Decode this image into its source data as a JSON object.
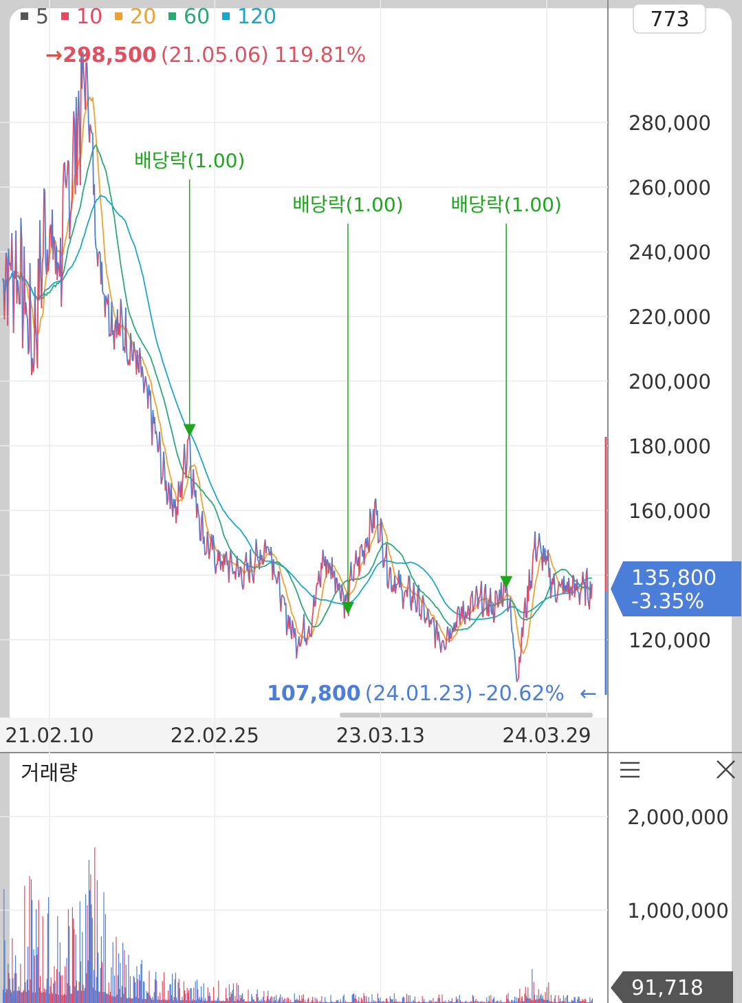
{
  "header": {
    "ma_legend": [
      {
        "label": "5",
        "color": "#555555"
      },
      {
        "label": "10",
        "color": "#e8475f"
      },
      {
        "label": "20",
        "color": "#f0a030"
      },
      {
        "label": "60",
        "color": "#2aa876"
      },
      {
        "label": "120",
        "color": "#1aa6c8"
      }
    ],
    "count_badge": "773"
  },
  "high_marker": {
    "arrow": "→",
    "price": "298,500",
    "date": "(21.05.06)",
    "pct": "119.81%",
    "color": "#e05060"
  },
  "low_marker": {
    "price": "107,800",
    "date": "(24.01.23)",
    "pct": "-20.62%",
    "arrow": "←",
    "color": "#4a7ed8"
  },
  "current": {
    "price": "135,800",
    "change": "-3.35%",
    "color": "#4a7ed8"
  },
  "dividend_marks": [
    {
      "label": "배당락(1.00)",
      "date": "2021-12-29"
    },
    {
      "label": "배당락(1.00)",
      "date": "2022-12-28"
    },
    {
      "label": "배당락(1.00)",
      "date": "2023-12-27"
    }
  ],
  "volume_panel": {
    "title": "거래량",
    "current_volume": "91,718",
    "menu_icon": "hamburger-icon",
    "close_icon": "close-icon"
  },
  "chart_data": [
    {
      "type": "line",
      "name": "price",
      "x_tick_labels": [
        "21.02.10",
        "22.02.25",
        "23.03.13",
        "24.03.29"
      ],
      "x_tick_dates": [
        "2021-02-10",
        "2022-02-25",
        "2023-03-13",
        "2024-03-29"
      ],
      "y_tick_labels": [
        "280,000",
        "260,000",
        "240,000",
        "220,000",
        "200,000",
        "180,000",
        "160,000",
        "140,000",
        "120,000"
      ],
      "ylim": [
        100000,
        300000
      ],
      "x": [
        "2020-12-01",
        "2021-01-04",
        "2021-02-01",
        "2021-03-02",
        "2021-04-01",
        "2021-05-06",
        "2021-06-01",
        "2021-07-01",
        "2021-08-02",
        "2021-09-01",
        "2021-10-01",
        "2021-11-01",
        "2021-12-01",
        "2021-12-29",
        "2022-01-03",
        "2022-02-03",
        "2022-03-02",
        "2022-04-01",
        "2022-05-02",
        "2022-06-02",
        "2022-07-01",
        "2022-08-01",
        "2022-09-01",
        "2022-10-04",
        "2022-11-01",
        "2022-12-01",
        "2022-12-28",
        "2023-01-02",
        "2023-02-01",
        "2023-03-02",
        "2023-04-03",
        "2023-05-02",
        "2023-06-01",
        "2023-07-03",
        "2023-08-01",
        "2023-09-01",
        "2023-10-04",
        "2023-11-01",
        "2023-12-01",
        "2023-12-27",
        "2024-01-23",
        "2024-02-01",
        "2024-03-04",
        "2024-04-01",
        "2024-04-15"
      ],
      "y": [
        235000,
        210000,
        250000,
        235000,
        265000,
        298500,
        240000,
        220000,
        215000,
        205000,
        190000,
        170000,
        160000,
        185000,
        170000,
        150000,
        145000,
        143000,
        140000,
        145000,
        150000,
        130000,
        120000,
        125000,
        145000,
        140000,
        130000,
        138000,
        148000,
        160000,
        140000,
        135000,
        133000,
        125000,
        120000,
        126000,
        130000,
        132000,
        130000,
        138000,
        107800,
        122000,
        150000,
        142000,
        135800
      ],
      "moving_averages": [
        "5",
        "10",
        "20",
        "60",
        "120"
      ]
    },
    {
      "type": "bar",
      "name": "volume",
      "y_tick_labels": [
        "2,000,000",
        "1,000,000"
      ],
      "ylim": [
        0,
        2300000
      ],
      "x": [
        "2021-01",
        "2021-03",
        "2021-05",
        "2021-07",
        "2021-09",
        "2021-11",
        "2022-01",
        "2022-03",
        "2022-05",
        "2022-07",
        "2022-09",
        "2022-11",
        "2023-01",
        "2023-03",
        "2023-05",
        "2023-07",
        "2023-09",
        "2023-11",
        "2024-01",
        "2024-03",
        "2024-04"
      ],
      "values": [
        1400000,
        1000000,
        1900000,
        700000,
        500000,
        350000,
        300000,
        250000,
        200000,
        120000,
        100000,
        90000,
        110000,
        130000,
        100000,
        95000,
        90000,
        85000,
        120000,
        500000,
        91718
      ]
    }
  ]
}
